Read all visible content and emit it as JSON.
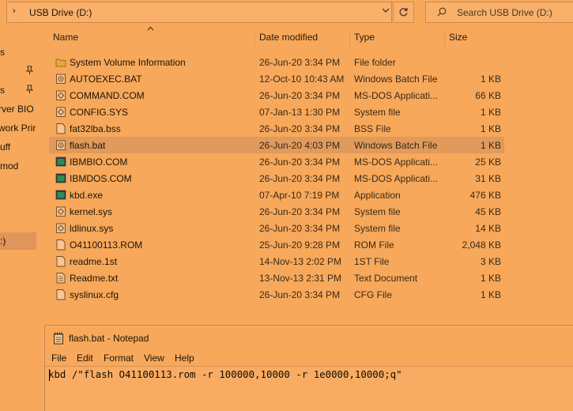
{
  "address_bar": {
    "path_glyph": "›",
    "path": "USB Drive (D:)",
    "dropdown_icon": "chevron-down-icon",
    "refresh_icon": "refresh-icon",
    "search_placeholder": "Search USB Drive (D:)"
  },
  "nav_pane": {
    "items": [
      {
        "label": "s",
        "pinned": false
      },
      {
        "label": "",
        "pinned": true
      },
      {
        "label": "s",
        "pinned": true
      },
      {
        "label": "rver BIO",
        "pinned": false
      },
      {
        "label": "work Prir",
        "pinned": false
      },
      {
        "label": "uff",
        "pinned": false
      },
      {
        "label": "mod",
        "pinned": false
      },
      {
        "label": ":)",
        "pinned": false,
        "selected": true
      }
    ],
    "pin_glyph": "📌"
  },
  "columns": {
    "name": "Name",
    "date": "Date modified",
    "type": "Type",
    "size": "Size",
    "sort_glyph": "^"
  },
  "files": [
    {
      "name": "System Volume Information",
      "date": "26-Jun-20 3:34 PM",
      "type": "File folder",
      "size": "",
      "icon": "folder-icon"
    },
    {
      "name": "AUTOEXEC.BAT",
      "date": "12-Oct-10 10:43 AM",
      "type": "Windows Batch File",
      "size": "1 KB",
      "icon": "batch-file-icon"
    },
    {
      "name": "COMMAND.COM",
      "date": "26-Jun-20 3:34 PM",
      "type": "MS-DOS Applicati...",
      "size": "66 KB",
      "icon": "system-file-icon"
    },
    {
      "name": "CONFIG.SYS",
      "date": "07-Jan-13 1:30 PM",
      "type": "System file",
      "size": "1 KB",
      "icon": "system-file-icon"
    },
    {
      "name": "fat32lba.bss",
      "date": "26-Jun-20 3:34 PM",
      "type": "BSS File",
      "size": "1 KB",
      "icon": "file-icon"
    },
    {
      "name": "flash.bat",
      "date": "26-Jun-20 4:03 PM",
      "type": "Windows Batch File",
      "size": "1 KB",
      "icon": "batch-file-icon",
      "selected": true
    },
    {
      "name": "IBMBIO.COM",
      "date": "26-Jun-20 3:34 PM",
      "type": "MS-DOS Applicati...",
      "size": "25 KB",
      "icon": "dos-app-icon"
    },
    {
      "name": "IBMDOS.COM",
      "date": "26-Jun-20 3:34 PM",
      "type": "MS-DOS Applicati...",
      "size": "31 KB",
      "icon": "dos-app-icon"
    },
    {
      "name": "kbd.exe",
      "date": "07-Apr-10 7:19 PM",
      "type": "Application",
      "size": "476 KB",
      "icon": "dos-app-icon"
    },
    {
      "name": "kernel.sys",
      "date": "26-Jun-20 3:34 PM",
      "type": "System file",
      "size": "45 KB",
      "icon": "system-file-icon"
    },
    {
      "name": "ldlinux.sys",
      "date": "26-Jun-20 3:34 PM",
      "type": "System file",
      "size": "14 KB",
      "icon": "system-file-icon"
    },
    {
      "name": "O41100113.ROM",
      "date": "25-Jun-20 9:28 PM",
      "type": "ROM File",
      "size": "2,048 KB",
      "icon": "file-icon"
    },
    {
      "name": "readme.1st",
      "date": "14-Nov-13 2:02 PM",
      "type": "1ST File",
      "size": "3 KB",
      "icon": "file-icon"
    },
    {
      "name": "Readme.txt",
      "date": "13-Nov-13 2:31 PM",
      "type": "Text Document",
      "size": "1 KB",
      "icon": "text-document-icon"
    },
    {
      "name": "syslinux.cfg",
      "date": "26-Jun-20 3:34 PM",
      "type": "CFG File",
      "size": "1 KB",
      "icon": "file-icon"
    }
  ],
  "notepad": {
    "title": "flash.bat - Notepad",
    "menu": [
      "File",
      "Edit",
      "Format",
      "View",
      "Help"
    ],
    "content": "kbd /\"flash O41100113.rom -r 100000,10000 -r 1e0000,10000;q\""
  },
  "colors": {
    "background": "#f7a85a",
    "selection": "#e09a5c",
    "text": "#1e1408"
  }
}
